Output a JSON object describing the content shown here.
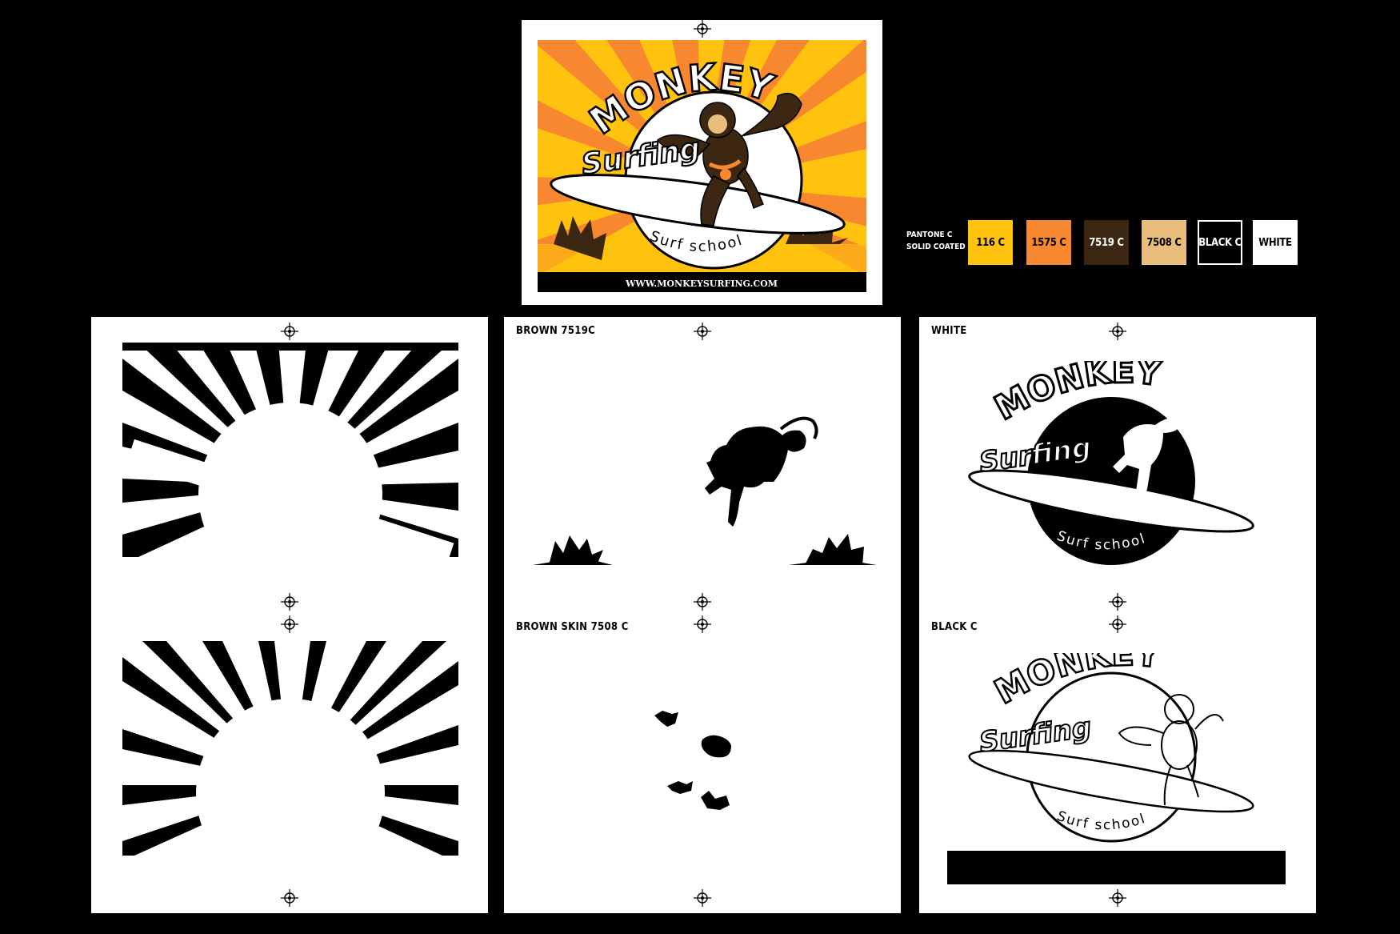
{
  "poster": {
    "title": "MONKEY",
    "script": "Surfing",
    "subtitle": "Surf school",
    "url": "WWW.MONKEYSURFING.COM"
  },
  "palette": {
    "label_line1": "PANTONE C",
    "label_line2": "SOLID COATED",
    "swatches": [
      {
        "name": "116 C",
        "color": "#FFC20E",
        "text_color": "#000000"
      },
      {
        "name": "1575 C",
        "color": "#F7882F",
        "text_color": "#000000"
      },
      {
        "name": "7519 C",
        "color": "#3B2712",
        "text_color": "#FFFFFF"
      },
      {
        "name": "7508 C",
        "color": "#E9BE7D",
        "text_color": "#000000"
      },
      {
        "name": "BLACK C",
        "color": "#000000",
        "text_color": "#FFFFFF"
      },
      {
        "name": "WHITE",
        "color": "#FFFFFF",
        "text_color": "#000000"
      }
    ]
  },
  "separations": {
    "brown": "BROWN  7519C",
    "brown_skin": "BROWN SKIN 7508 C",
    "white": "WHITE",
    "black": "BLACK C"
  },
  "icons": {
    "registration": "registration-mark-icon"
  }
}
